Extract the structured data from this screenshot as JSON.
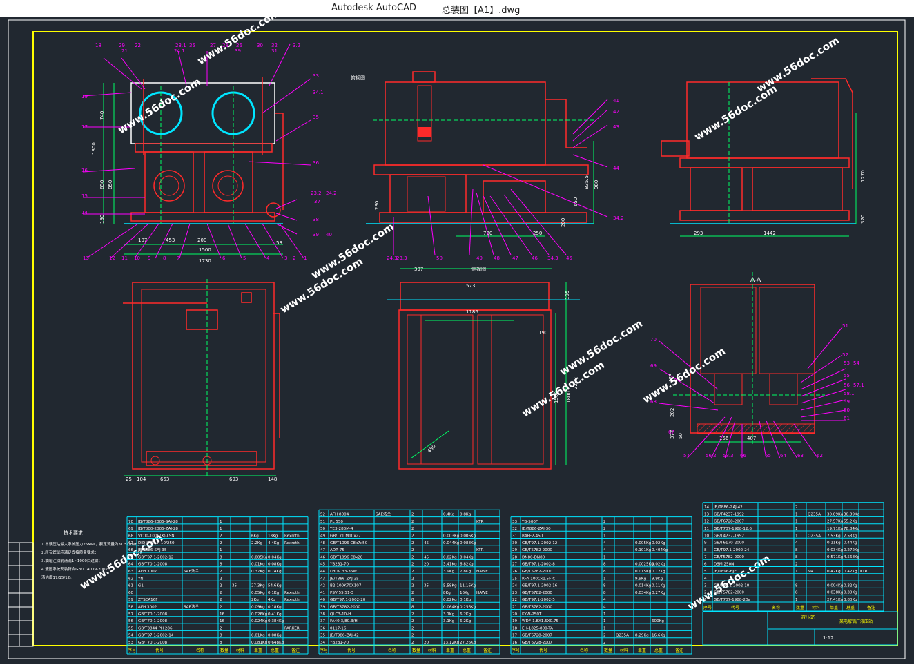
{
  "window": {
    "app_name": "Autodesk AutoCAD",
    "document_title": "总装图【A1】.dwg"
  },
  "drawing": {
    "watermark": "www.56doc.com",
    "section_label": "A-A",
    "view_labels": [
      "俯视图",
      "侧视图"
    ],
    "front_view_dims": [
      "1800",
      "740",
      "650",
      "850",
      "190",
      "107",
      "453",
      "200",
      "1500",
      "1730",
      "53"
    ],
    "side_view_dims": [
      "780",
      "250",
      "980",
      "835.5",
      "650",
      "280",
      "200"
    ],
    "right_view_dims": [
      "293",
      "1442",
      "1270",
      "320"
    ],
    "plan_view_dims": [
      "25",
      "104",
      "653",
      "693",
      "148"
    ],
    "mid_plan_dims": [
      "397",
      "573",
      "1186",
      "190",
      "1500",
      "1800",
      "2288",
      "195",
      "480"
    ],
    "section_dims": [
      "473",
      "202",
      "377",
      "50",
      "156",
      "407"
    ],
    "front_balloons": [
      "18",
      "29",
      "21",
      "22",
      "23.1",
      "24.1",
      "35",
      "27",
      "28",
      "26",
      "39",
      "30",
      "31",
      "3.2",
      "32",
      "33",
      "34.1",
      "35",
      "36",
      "23.2",
      "24.2",
      "37",
      "38",
      "39",
      "40",
      "13",
      "12",
      "11",
      "10",
      "9",
      "8",
      "7",
      "6",
      "5",
      "4",
      "3",
      "2",
      "1",
      "14",
      "15",
      "16",
      "17",
      "19"
    ],
    "side_balloons": [
      "41",
      "42",
      "43",
      "44",
      "34.2",
      "45",
      "34.3",
      "46",
      "47",
      "48",
      "49",
      "50",
      "24.3",
      "23.3"
    ],
    "section_balloons": [
      "51",
      "52",
      "53",
      "54",
      "55",
      "56",
      "57.1",
      "58.1",
      "59",
      "60",
      "61",
      "62",
      "63",
      "64",
      "65",
      "66",
      "58.3",
      "56.2",
      "57",
      "67",
      "68",
      "69",
      "70"
    ]
  },
  "notes": {
    "title": "技术要求",
    "lines": [
      "1.本液压站最大系统压力25MPa，额定流量为31.5L/min；",
      "2.所有焊缝应满足焊接质量要求；",
      "3.油箱注油前清洗1~1000目过滤；",
      "4.液压系统安装符合GB/T14039-2002",
      "清洁度17/15/12。"
    ]
  },
  "bom": {
    "columns": [
      "序号",
      "代号",
      "名称",
      "数量",
      "材料",
      "单重",
      "总重",
      "备注"
    ],
    "left_rows": [
      [
        "70",
        "JB/T886-2005-SAJ-28",
        "",
        "1",
        "",
        "",
        "",
        ""
      ],
      [
        "69",
        "JB/T000-2005-ZAJ-28",
        "",
        "1",
        "",
        "",
        "",
        ""
      ],
      [
        "68",
        "VC00-100R(X)-LSN",
        "",
        "2",
        "",
        "6Kg",
        "13Kg",
        "Rexroth"
      ],
      [
        "67",
        "DID-H-25-P-10/250",
        "",
        "2",
        "",
        "2.2Kg",
        "4.4Kg",
        "Rexroth"
      ],
      [
        "66",
        "JB/T886-SAJ-35",
        "",
        "1",
        "",
        "",
        "",
        ""
      ],
      [
        "65",
        "GB/T97.1-2002-12",
        "",
        "8",
        "",
        "0.005Kg",
        "0.04Kg",
        ""
      ],
      [
        "64",
        "GB/T70.1-2008",
        "",
        "8",
        "",
        "0.01Kg",
        "0.08Kg",
        ""
      ],
      [
        "63",
        "AFH 3007",
        "SAE法兰",
        "2",
        "",
        "0.37Kg",
        "0.74Kg",
        ""
      ],
      [
        "62",
        "YN",
        "",
        "2",
        "",
        "",
        "",
        ""
      ],
      [
        "61",
        "G1",
        "",
        "2",
        "35",
        "27.3Kg",
        "54.6Kg",
        ""
      ],
      [
        "60",
        "",
        "",
        "2",
        "",
        "0.05Kg",
        "0.1Kg",
        "Rexroth"
      ],
      [
        "59",
        "ZTSEA16F",
        "",
        "2",
        "",
        "2Kg",
        "4Kg",
        "Rexroth"
      ],
      [
        "58",
        "AFH 3002",
        "SAE法兰",
        "2",
        "",
        "0.09Kg",
        "0.18Kg",
        ""
      ],
      [
        "57",
        "GB/T70.1-2008",
        "",
        "16",
        "",
        "0.026Kg",
        "0.41Kg",
        ""
      ],
      [
        "56",
        "GB/T70.1-2008",
        "",
        "16",
        "",
        "0.024Kg",
        "0.384Kg",
        ""
      ],
      [
        "55",
        "GB/T3844 PH 286",
        "",
        "2",
        "",
        "",
        "",
        "PARKER"
      ],
      [
        "54",
        "GB/T97.1-2002-14",
        "",
        "8",
        "",
        "0.01Kg",
        "0.08Kg",
        ""
      ],
      [
        "53",
        "GB/T70.1-2008",
        "",
        "8",
        "",
        "0.081Kg",
        "0.648Kg",
        ""
      ]
    ],
    "mid_rows": [
      [
        "52",
        "AFH 8004",
        "SAE法兰",
        "2",
        "",
        "0.4Kg",
        "0.8Kg",
        ""
      ],
      [
        "51",
        "PL 550",
        "",
        "2",
        "",
        "",
        "",
        "KTR"
      ],
      [
        "50",
        "YE3-280M-4",
        "",
        "2",
        "",
        "",
        "",
        ""
      ],
      [
        "49",
        "GB/T71 M10x27",
        "",
        "2",
        "",
        "0.003Kg",
        "0.006Kg",
        ""
      ],
      [
        "48",
        "GB/T1096 C8x7x50",
        "",
        "2",
        "45",
        "0.044Kg",
        "0.088Kg",
        ""
      ],
      [
        "47",
        "ADR 75",
        "",
        "2",
        "",
        "",
        "",
        "KTR"
      ],
      [
        "46",
        "GB/T1096 C8x28",
        "",
        "2",
        "45",
        "0.02Kg",
        "0.04Kg",
        ""
      ],
      [
        "45",
        "YB231-70",
        "",
        "2",
        "20",
        "3.41Kg",
        "6.82Kg",
        ""
      ],
      [
        "44",
        "LHDV 33-35W",
        "",
        "2",
        "",
        "3.9Kg",
        "7.8Kg",
        "HAWE"
      ],
      [
        "43",
        "JB/T886-ZAJ-35",
        "",
        "2",
        "",
        "",
        "",
        ""
      ],
      [
        "42",
        "B2-100K70X107",
        "",
        "2",
        "35",
        "5.58Kg",
        "11.16Kg",
        ""
      ],
      [
        "41",
        "PSV 55 S1-3",
        "",
        "2",
        "",
        "8Kg",
        "16Kg",
        "HAWE"
      ],
      [
        "40",
        "GB/T97.1-2002-20",
        "",
        "8",
        "",
        "0.02Kg",
        "0.1Kg",
        ""
      ],
      [
        "39",
        "GB/T5782-2000",
        "",
        "8",
        "",
        "0.064Kg",
        "0.256Kg",
        ""
      ],
      [
        "38",
        "QLC3-10-H",
        "",
        "2",
        "",
        "3.1Kg",
        "6.2Kg",
        ""
      ],
      [
        "37",
        "FA40-3/80.3/H",
        "",
        "2",
        "",
        "3.1Kg",
        "6.2Kg",
        ""
      ],
      [
        "36",
        "0117-16",
        "",
        "2",
        "",
        "",
        "",
        ""
      ],
      [
        "35",
        "JB/T986-ZAJ-42",
        "",
        "2",
        "",
        "",
        "",
        ""
      ],
      [
        "34",
        "YB231-70",
        "",
        "2",
        "20",
        "13.12Kg",
        "27.26Kg",
        ""
      ]
    ],
    "right_rows": [
      [
        "33",
        "YB-500F",
        "",
        "2",
        "",
        "",
        "",
        ""
      ],
      [
        "32",
        "JB/T886-ZAJ-30",
        "",
        "2",
        "",
        "",
        "",
        ""
      ],
      [
        "31",
        "BAFF2-450",
        "",
        "1",
        "",
        "",
        "",
        ""
      ],
      [
        "30",
        "GB/T97.1-2002-12",
        "",
        "4",
        "",
        "0.005Kg",
        "0.02Kg",
        ""
      ],
      [
        "29",
        "GB/T5782-2000",
        "",
        "4",
        "",
        "0.101Kg",
        "0.404Kg",
        ""
      ],
      [
        "28",
        "DN80-DN80",
        "",
        "1",
        "",
        "",
        "",
        ""
      ],
      [
        "27",
        "GB/T97.1-2002-8",
        "",
        "8",
        "",
        "0.0025Kg",
        "0.02Kg",
        ""
      ],
      [
        "26",
        "GB/T5782-2000",
        "",
        "8",
        "",
        "0.015Kg",
        "0.12Kg",
        ""
      ],
      [
        "25",
        "RFA-100Cx1.5F-C",
        "",
        "1",
        "",
        "9.9Kg",
        "9.9Kg",
        ""
      ],
      [
        "24",
        "GB/T97.1-2002-16",
        "",
        "8",
        "",
        "0.014Kg",
        "0.11Kg",
        ""
      ],
      [
        "23",
        "GB/T5782-2000",
        "",
        "8",
        "",
        "0.034Kg",
        "0.27Kg",
        ""
      ],
      [
        "22",
        "GB/T97.1-2002-5",
        "",
        "4",
        "",
        "",
        "",
        ""
      ],
      [
        "21",
        "GB/T5782-2000",
        "",
        "4",
        "",
        "",
        "",
        ""
      ],
      [
        "20",
        "KYW-250T",
        "",
        "1",
        "",
        "",
        "",
        ""
      ],
      [
        "19",
        "WDF-1.8X1.5X0.75",
        "",
        "1",
        "",
        "",
        "600Kg",
        ""
      ],
      [
        "18",
        "EH-1825-800-TA",
        "",
        "1",
        "",
        "",
        "",
        ""
      ],
      [
        "17",
        "GB/T6728-2007",
        "",
        "2",
        "Q235A",
        "8.29Kg",
        "16.6Kg",
        ""
      ],
      [
        "16",
        "GB/T6728-2007",
        "",
        "2",
        "",
        "",
        "",
        ""
      ]
    ],
    "far_rows": [
      [
        "14",
        "JB/T886-ZAJ-42",
        "",
        "2",
        "",
        "",
        "",
        ""
      ],
      [
        "13",
        "GB/T4237-1992",
        "",
        "1",
        "Q235A",
        "30.89Kg",
        "30.89Kg",
        ""
      ],
      [
        "12",
        "GB/T6728-2007",
        "",
        "1",
        "",
        "27.57Kg",
        "55.2Kg",
        ""
      ],
      [
        "11",
        "GB/T707-1988-12.6",
        "",
        "1",
        "",
        "19.71Kg",
        "78.84Kg",
        ""
      ],
      [
        "10",
        "GB/T4237-1992",
        "",
        "1",
        "Q235A",
        "7.53Kg",
        "7.53Kg",
        ""
      ],
      [
        "9",
        "GB/T6170-2000",
        "",
        "4",
        "",
        "0.11Kg",
        "0.44Kg",
        ""
      ],
      [
        "8",
        "GB/T97.1-2002-24",
        "",
        "8",
        "",
        "0.034Kg",
        "0.272Kg",
        ""
      ],
      [
        "7",
        "GB/T5782-2000",
        "",
        "8",
        "",
        "0.571Kg",
        "4.568Kg",
        ""
      ],
      [
        "6",
        "DSM 250N",
        "",
        "2",
        "",
        "",
        "",
        ""
      ],
      [
        "5",
        "JB/T896-HJE",
        "",
        "1",
        "NR",
        "0.42Kg",
        "0.42Kg",
        "KTR"
      ],
      [
        "4",
        "",
        "",
        "",
        "",
        "",
        "",
        ""
      ],
      [
        "3",
        "GB/T97.1-2002-10",
        "",
        "8",
        "",
        "0.004Kg",
        "0.32Kg",
        ""
      ],
      [
        "2",
        "GB/T5782-2000",
        "",
        "8",
        "",
        "0.038Kg",
        "0.30Kg",
        ""
      ],
      [
        "1",
        "GB/T707-1988-20a",
        "",
        "1",
        "",
        "27.41Kg",
        "3.80Kg",
        ""
      ]
    ]
  },
  "title_block": {
    "title": "某电解铝厂液压站",
    "drawing_name": "液压站",
    "scale": "1:12"
  }
}
